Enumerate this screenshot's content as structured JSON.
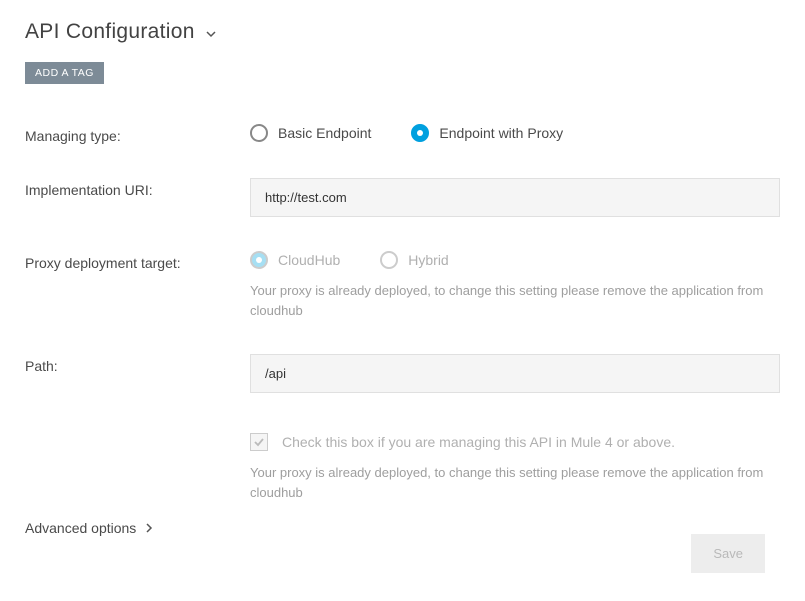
{
  "header": {
    "title": "API Configuration",
    "tag_button": "ADD A TAG"
  },
  "form": {
    "managing_type": {
      "label": "Managing type:",
      "options": {
        "basic": "Basic Endpoint",
        "proxy": "Endpoint with Proxy"
      }
    },
    "implementation_uri": {
      "label": "Implementation URI:",
      "value": "http://test.com"
    },
    "proxy_target": {
      "label": "Proxy deployment target:",
      "options": {
        "cloudhub": "CloudHub",
        "hybrid": "Hybrid"
      },
      "helper": "Your proxy is already deployed, to change this setting please remove the application from cloudhub"
    },
    "path": {
      "label": "Path:",
      "value": "/api"
    },
    "mule4": {
      "label": "Check this box if you are managing this API in Mule 4 or above.",
      "helper": "Your proxy is already deployed, to change this setting please remove the application from cloudhub"
    },
    "advanced": "Advanced options",
    "save": "Save"
  }
}
